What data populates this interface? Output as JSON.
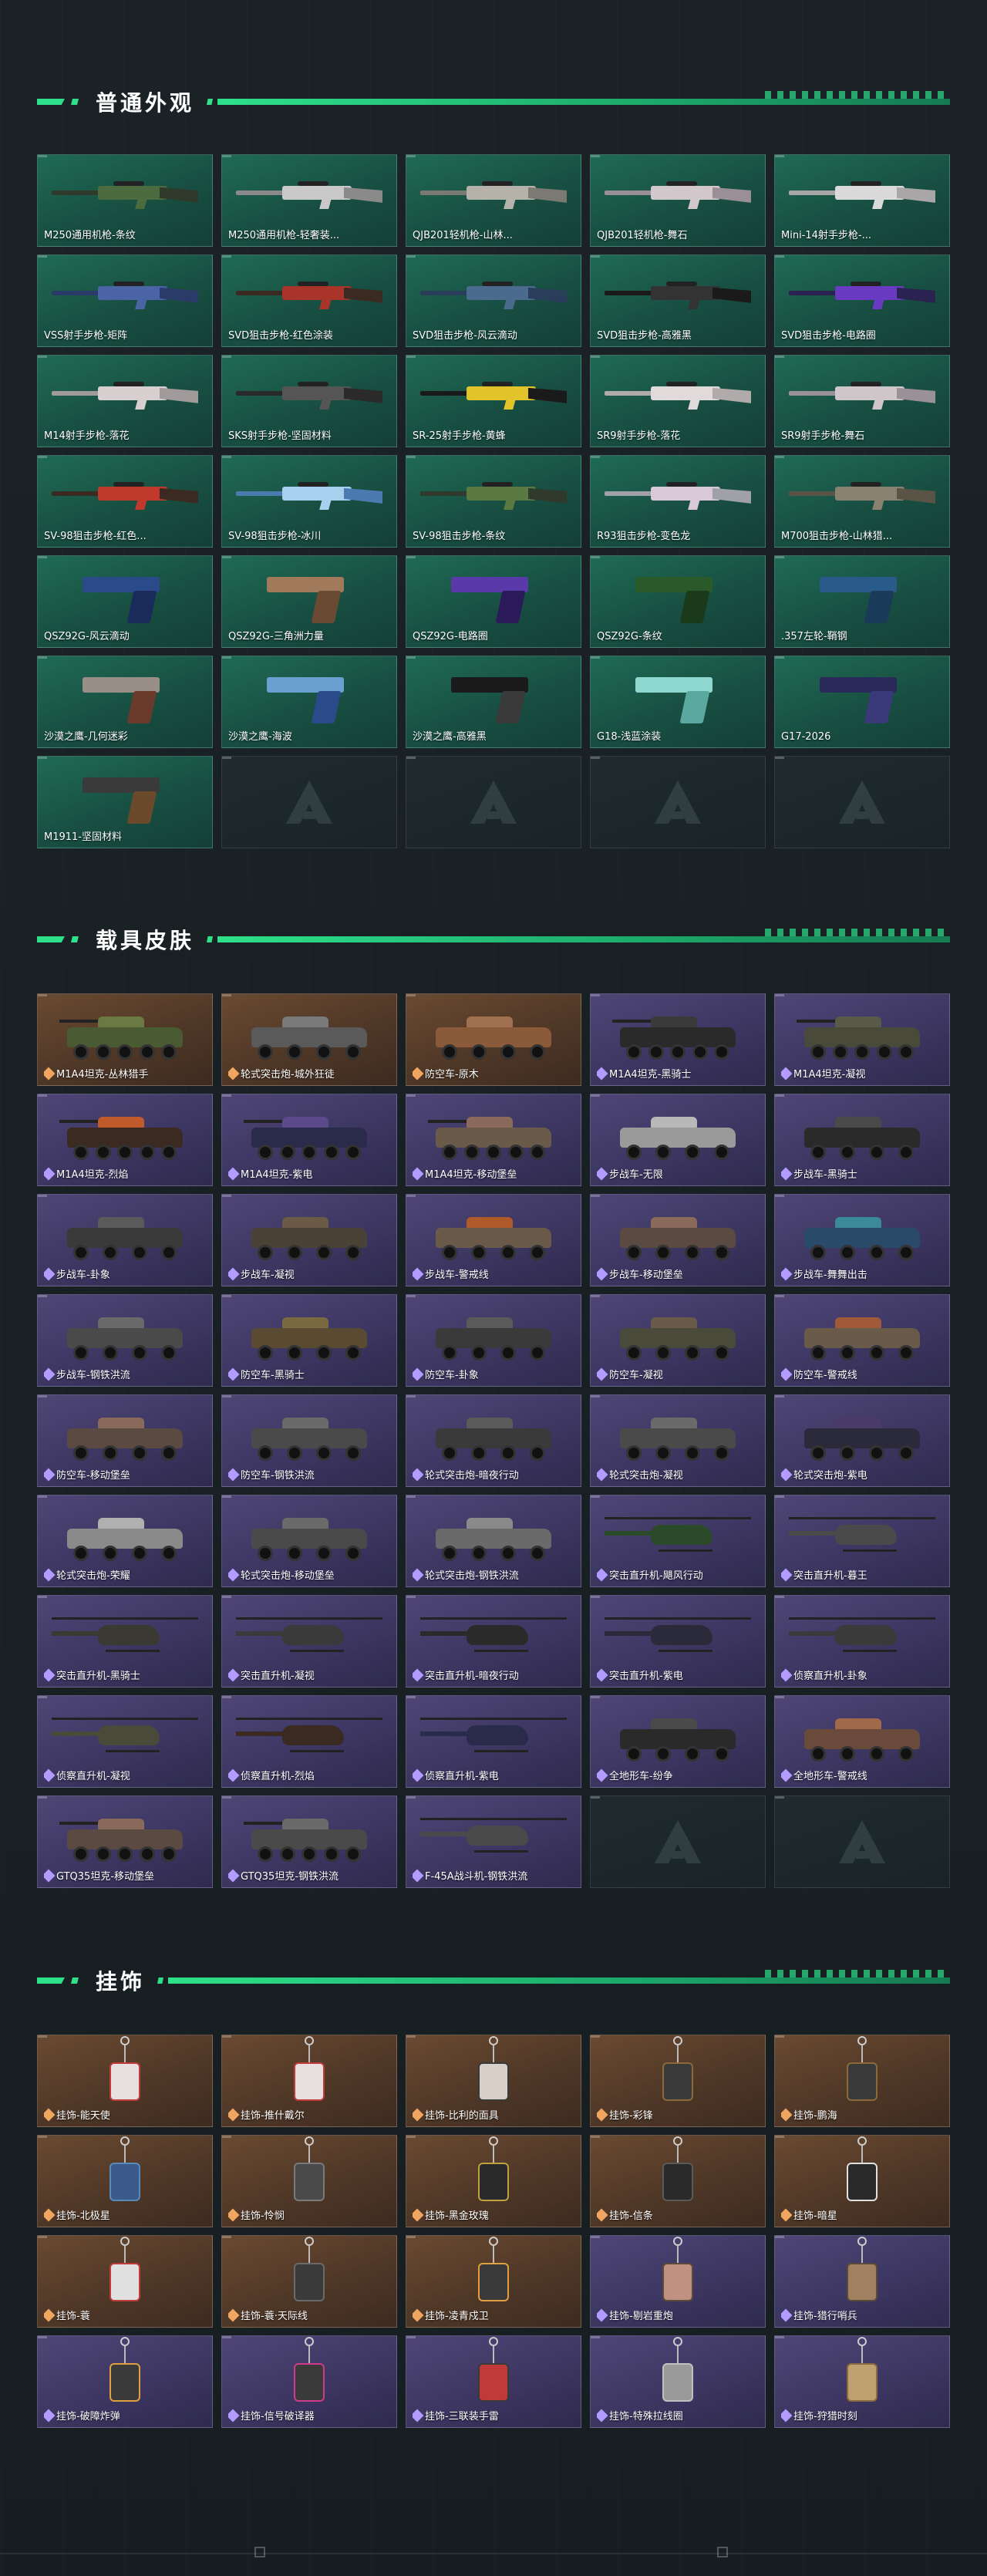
{
  "sections": [
    {
      "title": "普通外观",
      "items": [
        {
          "label": "M250通用机枪-条纹",
          "kind": "rifle",
          "c1": "#2f3a2c",
          "c2": "#4c6b3e"
        },
        {
          "label": "M250通用机枪-轻奢装...",
          "kind": "rifle",
          "c1": "#8a8a8a",
          "c2": "#c9c9c9"
        },
        {
          "label": "QJB201轻机枪-山林...",
          "kind": "rifle",
          "c1": "#7a7a72",
          "c2": "#b5b2aa"
        },
        {
          "label": "QJB201轻机枪-舞石",
          "kind": "rifle",
          "c1": "#9a8f96",
          "c2": "#d2c8cc"
        },
        {
          "label": "Mini-14射手步枪-...",
          "kind": "rifle",
          "c1": "#a9a6a8",
          "c2": "#dadada"
        },
        {
          "label": "VSS射手步枪-矩阵",
          "kind": "rifle",
          "c1": "#2a3b6a",
          "c2": "#4a64a6"
        },
        {
          "label": "SVD狙击步枪-红色涂装",
          "kind": "rifle",
          "c1": "#3a2a22",
          "c2": "#a8342a"
        },
        {
          "label": "SVD狙击步枪-风云滴动",
          "kind": "rifle",
          "c1": "#2a3d5a",
          "c2": "#4a6a8e"
        },
        {
          "label": "SVD狙击步枪-高雅黑",
          "kind": "rifle",
          "c1": "#1a1a1a",
          "c2": "#333333"
        },
        {
          "label": "SVD狙击步枪-电路圈",
          "kind": "rifle",
          "c1": "#2a2250",
          "c2": "#6a3ac2"
        },
        {
          "label": "M14射手步枪-落花",
          "kind": "rifle",
          "c1": "#a09a9a",
          "c2": "#d8d0d0"
        },
        {
          "label": "SKS射手步枪-坚固材料",
          "kind": "rifle",
          "c1": "#2a2a2a",
          "c2": "#555555"
        },
        {
          "label": "SR-25射手步枪-黄蜂",
          "kind": "rifle",
          "c1": "#1a1a1a",
          "c2": "#e2c42a"
        },
        {
          "label": "SR9射手步枪-落花",
          "kind": "rifle",
          "c1": "#b0aaaa",
          "c2": "#e0dada"
        },
        {
          "label": "SR9射手步枪-舞石",
          "kind": "rifle",
          "c1": "#9a9196",
          "c2": "#cfc6ca"
        },
        {
          "label": "SV-98狙击步枪-红色...",
          "kind": "rifle",
          "c1": "#3a2a22",
          "c2": "#c0392b"
        },
        {
          "label": "SV-98狙击步枪-冰川",
          "kind": "rifle",
          "c1": "#4a7ab0",
          "c2": "#a8d0ee"
        },
        {
          "label": "SV-98狙击步枪-条纹",
          "kind": "rifle",
          "c1": "#2f3a2c",
          "c2": "#5a7a42"
        },
        {
          "label": "R93狙击步枪-变色龙",
          "kind": "rifle",
          "c1": "#a0a0a8",
          "c2": "#d8c8d8"
        },
        {
          "label": "M700狙击步枪-山林猎...",
          "kind": "rifle",
          "c1": "#5a5446",
          "c2": "#8a8270"
        },
        {
          "label": "QSZ92G-风云滴动",
          "kind": "pistol",
          "c1": "#2a4a8a",
          "c2": "#1a2a5a"
        },
        {
          "label": "QSZ92G-三角洲力量",
          "kind": "pistol",
          "c1": "#a07a5a",
          "c2": "#6a4a32"
        },
        {
          "label": "QSZ92G-电路圈",
          "kind": "pistol",
          "c1": "#5a3aa8",
          "c2": "#2a1a5a"
        },
        {
          "label": "QSZ92G-条纹",
          "kind": "pistol",
          "c1": "#2a5a2a",
          "c2": "#1a3a1a"
        },
        {
          "label": ".357左轮-鞘钢",
          "kind": "pistol",
          "c1": "#2a5a8a",
          "c2": "#1a3a5a"
        },
        {
          "label": "沙漠之鹰-几何迷彩",
          "kind": "pistol",
          "c1": "#9a8f86",
          "c2": "#6a3a2a"
        },
        {
          "label": "沙漠之鹰-海波",
          "kind": "pistol",
          "c1": "#6aa0d0",
          "c2": "#2a4a8a"
        },
        {
          "label": "沙漠之鹰-高雅黑",
          "kind": "pistol",
          "c1": "#1a1a1a",
          "c2": "#3a3a3a"
        },
        {
          "label": "G18-浅蓝涂装",
          "kind": "pistol",
          "c1": "#8fd8d0",
          "c2": "#5aa8a0"
        },
        {
          "label": "G17-2026",
          "kind": "pistol",
          "c1": "#2a2a5a",
          "c2": "#3a3a7a"
        },
        {
          "label": "M1911-坚固材料",
          "kind": "pistol",
          "c1": "#3a3a3a",
          "c2": "#6a4a2a"
        },
        {
          "label": "",
          "kind": "empty"
        },
        {
          "label": "",
          "kind": "empty"
        },
        {
          "label": "",
          "kind": "empty"
        },
        {
          "label": "",
          "kind": "empty"
        }
      ]
    },
    {
      "title": "载具皮肤",
      "items": [
        {
          "label": "M1A4坦克-丛林猎手",
          "kind": "tank",
          "tone": "orange",
          "c1": "#4a5a32",
          "c2": "#6a7a42"
        },
        {
          "label": "轮式突击炮-城外狂徒",
          "kind": "apc",
          "tone": "orange",
          "c1": "#5a5a5a",
          "c2": "#7a7a7a"
        },
        {
          "label": "防空车-原木",
          "kind": "apc",
          "tone": "orange",
          "c1": "#8a5a3a",
          "c2": "#a07050"
        },
        {
          "label": "M1A4坦克-黑骑士",
          "kind": "tank",
          "tone": "purple",
          "c1": "#2a2a2a",
          "c2": "#3a3a3a"
        },
        {
          "label": "M1A4坦克-凝视",
          "kind": "tank",
          "tone": "purple",
          "c1": "#4a4a3a",
          "c2": "#5a5a4a"
        },
        {
          "label": "M1A4坦克-烈焰",
          "kind": "tank",
          "tone": "purple",
          "c1": "#3a2a22",
          "c2": "#c05a2a"
        },
        {
          "label": "M1A4坦克-紫电",
          "kind": "tank",
          "tone": "purple",
          "c1": "#2a2a4a",
          "c2": "#5a4a8a"
        },
        {
          "label": "M1A4坦克-移动堡垒",
          "kind": "tank",
          "tone": "purple",
          "c1": "#6a5a4a",
          "c2": "#8a6a5a"
        },
        {
          "label": "步战车-无限",
          "kind": "apc",
          "tone": "purple",
          "c1": "#9a9a9a",
          "c2": "#b8b8b8"
        },
        {
          "label": "步战车-黑骑士",
          "kind": "apc",
          "tone": "purple",
          "c1": "#2a2a2a",
          "c2": "#4a4a4a"
        },
        {
          "label": "步战车-卦象",
          "kind": "apc",
          "tone": "purple",
          "c1": "#3a3a3a",
          "c2": "#5a5a5a"
        },
        {
          "label": "步战车-凝视",
          "kind": "apc",
          "tone": "purple",
          "c1": "#4a4236",
          "c2": "#6a5a46"
        },
        {
          "label": "步战车-警戒线",
          "kind": "apc",
          "tone": "purple",
          "c1": "#6a5a4a",
          "c2": "#b05a2a"
        },
        {
          "label": "步战车-移动堡垒",
          "kind": "apc",
          "tone": "purple",
          "c1": "#5a4a42",
          "c2": "#8a6a5a"
        },
        {
          "label": "步战车-舞舞出击",
          "kind": "apc",
          "tone": "purple",
          "c1": "#2a4a6a",
          "c2": "#3a8a9a"
        },
        {
          "label": "步战车-钢铁洪流",
          "kind": "apc",
          "tone": "purple",
          "c1": "#4a4a4a",
          "c2": "#6a6a6a"
        },
        {
          "label": "防空车-黑骑士",
          "kind": "apc",
          "tone": "purple",
          "c1": "#5a4a32",
          "c2": "#7a6a42"
        },
        {
          "label": "防空车-卦象",
          "kind": "apc",
          "tone": "purple",
          "c1": "#3a3a3a",
          "c2": "#5a5a5a"
        },
        {
          "label": "防空车-凝视",
          "kind": "apc",
          "tone": "purple",
          "c1": "#4a4a3a",
          "c2": "#6a5a4a"
        },
        {
          "label": "防空车-警戒线",
          "kind": "apc",
          "tone": "purple",
          "c1": "#6a5a4a",
          "c2": "#a05a3a"
        },
        {
          "label": "防空车-移动堡垒",
          "kind": "apc",
          "tone": "purple",
          "c1": "#5a4a42",
          "c2": "#8a6a5a"
        },
        {
          "label": "防空车-钢铁洪流",
          "kind": "apc",
          "tone": "purple",
          "c1": "#4a4a4a",
          "c2": "#6a6a6a"
        },
        {
          "label": "轮式突击炮-暗夜行动",
          "kind": "apc",
          "tone": "purple",
          "c1": "#3a3a3a",
          "c2": "#5a5a5a"
        },
        {
          "label": "轮式突击炮-凝视",
          "kind": "apc",
          "tone": "purple",
          "c1": "#4a4a4a",
          "c2": "#6a6a6a"
        },
        {
          "label": "轮式突击炮-紫电",
          "kind": "apc",
          "tone": "purple",
          "c1": "#2a2a3a",
          "c2": "#4a3a6a"
        },
        {
          "label": "轮式突击炮-荣耀",
          "kind": "apc",
          "tone": "purple",
          "c1": "#8a8a8a",
          "c2": "#b0b0b0"
        },
        {
          "label": "轮式突击炮-移动堡垒",
          "kind": "apc",
          "tone": "purple",
          "c1": "#4a4a4a",
          "c2": "#6a6a6a"
        },
        {
          "label": "轮式突击炮-钢铁洪流",
          "kind": "apc",
          "tone": "purple",
          "c1": "#6a6a6a",
          "c2": "#8a8a8a"
        },
        {
          "label": "突击直升机-飓风行动",
          "kind": "heli",
          "tone": "purple",
          "c1": "#2a4a2a",
          "c2": "#4aa04a"
        },
        {
          "label": "突击直升机-暮王",
          "kind": "heli",
          "tone": "purple",
          "c1": "#4a4a4a",
          "c2": "#a03a2a"
        },
        {
          "label": "突击直升机-黑骑士",
          "kind": "heli",
          "tone": "purple",
          "c1": "#3a3a32",
          "c2": "#5a5a4a"
        },
        {
          "label": "突击直升机-凝视",
          "kind": "heli",
          "tone": "purple",
          "c1": "#3a3a3a",
          "c2": "#5a5a5a"
        },
        {
          "label": "突击直升机-暗夜行动",
          "kind": "heli",
          "tone": "purple",
          "c1": "#2a2a2a",
          "c2": "#4a4a4a"
        },
        {
          "label": "突击直升机-紫电",
          "kind": "heli",
          "tone": "purple",
          "c1": "#2a2a3a",
          "c2": "#4a4a6a"
        },
        {
          "label": "侦察直升机-卦象",
          "kind": "heli",
          "tone": "purple",
          "c1": "#3a3a3a",
          "c2": "#5a5a5a"
        },
        {
          "label": "侦察直升机-凝视",
          "kind": "heli",
          "tone": "purple",
          "c1": "#4a4a3a",
          "c2": "#6a6a5a"
        },
        {
          "label": "侦察直升机-烈焰",
          "kind": "heli",
          "tone": "purple",
          "c1": "#3a2a22",
          "c2": "#c03a2a"
        },
        {
          "label": "侦察直升机-紫电",
          "kind": "heli",
          "tone": "purple",
          "c1": "#2a2a4a",
          "c2": "#4a4a8a"
        },
        {
          "label": "全地形车-纷争",
          "kind": "apc",
          "tone": "purple",
          "c1": "#2a2a2a",
          "c2": "#4a4a4a"
        },
        {
          "label": "全地形车-警戒线",
          "kind": "apc",
          "tone": "purple",
          "c1": "#6a4a3a",
          "c2": "#a06a4a"
        },
        {
          "label": "GTQ35坦克-移动堡垒",
          "kind": "tank",
          "tone": "purple",
          "c1": "#5a4a42",
          "c2": "#8a6a5a"
        },
        {
          "label": "GTQ35坦克-钢铁洪流",
          "kind": "tank",
          "tone": "purple",
          "c1": "#4a4a4a",
          "c2": "#6a6a6a"
        },
        {
          "label": "F-45A战斗机-钢铁洪流",
          "kind": "heli",
          "tone": "purple",
          "c1": "#4a4a4a",
          "c2": "#6a6a6a"
        },
        {
          "label": "",
          "kind": "empty"
        },
        {
          "label": "",
          "kind": "empty"
        }
      ]
    },
    {
      "title": "挂饰",
      "items": [
        {
          "label": "挂饰-能天使",
          "kind": "charm",
          "tone": "orange",
          "c1": "#e8e0e0",
          "c2": "#c03a3a"
        },
        {
          "label": "挂饰-推什戴尔",
          "kind": "charm",
          "tone": "orange",
          "c1": "#e8e0e0",
          "c2": "#c03a3a"
        },
        {
          "label": "挂饰-比利的面具",
          "kind": "charm",
          "tone": "orange",
          "c1": "#d8d0c8",
          "c2": "#3a3a3a"
        },
        {
          "label": "挂饰-彩锋",
          "kind": "charm",
          "tone": "orange",
          "c1": "#3a3a3a",
          "c2": "#8a6a3a"
        },
        {
          "label": "挂饰-鹏海",
          "kind": "charm",
          "tone": "orange",
          "c1": "#3a3a3a",
          "c2": "#8a6a3a"
        },
        {
          "label": "挂饰-北极星",
          "kind": "charm",
          "tone": "orange",
          "c1": "#3a5a8a",
          "c2": "#5a8aba"
        },
        {
          "label": "挂饰-怜悯",
          "kind": "charm",
          "tone": "orange",
          "c1": "#4a4a4a",
          "c2": "#7a7a7a"
        },
        {
          "label": "挂饰-黑金玫瑰",
          "kind": "charm",
          "tone": "orange",
          "c1": "#2a2a2a",
          "c2": "#c0a040"
        },
        {
          "label": "挂饰-信条",
          "kind": "charm",
          "tone": "orange",
          "c1": "#2a2a2a",
          "c2": "#5a5a5a"
        },
        {
          "label": "挂饰-暗星",
          "kind": "charm",
          "tone": "orange",
          "c1": "#2a2a2a",
          "c2": "#e0e0e0"
        },
        {
          "label": "挂饰-蓑",
          "kind": "charm",
          "tone": "orange",
          "c1": "#e0e0e0",
          "c2": "#c03a3a"
        },
        {
          "label": "挂饰-蓑·天际线",
          "kind": "charm",
          "tone": "orange",
          "c1": "#3a3a3a",
          "c2": "#6a6a6a"
        },
        {
          "label": "挂饰-凌青戍卫",
          "kind": "charm",
          "tone": "orange",
          "c1": "#3a3a3a",
          "c2": "#e0a040"
        },
        {
          "label": "挂饰-剔岩重炮",
          "kind": "charm",
          "tone": "purple",
          "c1": "#c09080",
          "c2": "#5a4a3a"
        },
        {
          "label": "挂饰-猎行哨兵",
          "kind": "charm",
          "tone": "purple",
          "c1": "#a08060",
          "c2": "#5a4a3a"
        },
        {
          "label": "挂饰-破障炸弹",
          "kind": "charm",
          "tone": "purple",
          "c1": "#3a3a3a",
          "c2": "#e0a040"
        },
        {
          "label": "挂饰-信号破译器",
          "kind": "charm",
          "tone": "purple",
          "c1": "#3a3a3a",
          "c2": "#d03a8a"
        },
        {
          "label": "挂饰-三联装手雷",
          "kind": "charm",
          "tone": "purple",
          "c1": "#c03a3a",
          "c2": "#3a3a3a"
        },
        {
          "label": "挂饰-特殊拉线圈",
          "kind": "charm",
          "tone": "purple",
          "c1": "#9a9a9a",
          "c2": "#c0c0c0"
        },
        {
          "label": "挂饰-狩猎时刻",
          "kind": "charm",
          "tone": "purple",
          "c1": "#c0a070",
          "c2": "#8a6a40"
        }
      ]
    }
  ]
}
